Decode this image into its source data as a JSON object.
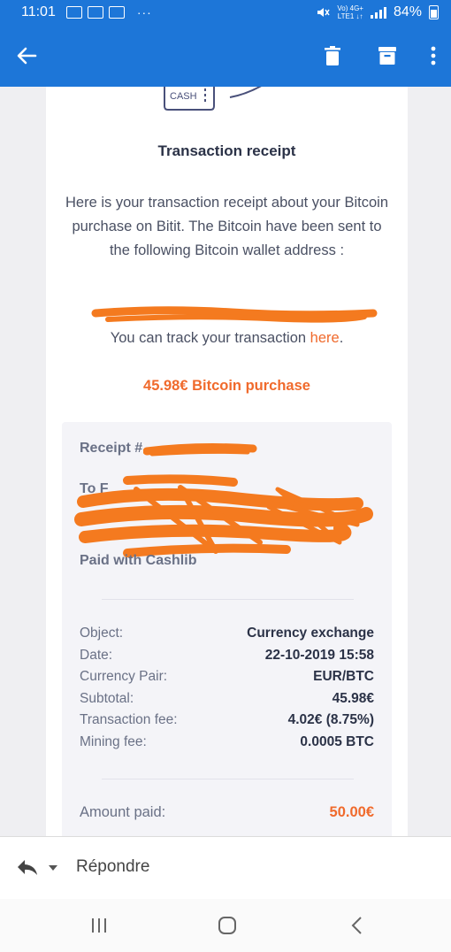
{
  "status": {
    "time": "11:01",
    "battery": "84%",
    "net_top": "Vo) 4G+",
    "net_bottom": "LTE1 ↓↑",
    "dots": "···"
  },
  "header": {
    "back_label": "Back",
    "actions": [
      "delete",
      "archive",
      "more"
    ]
  },
  "email": {
    "title": "Transaction receipt",
    "intro": "Here is your transaction receipt about your Bitcoin purchase on Bitit. The Bitcoin have been sent to the following Bitcoin wallet address :",
    "track_prefix": "You can track your transaction ",
    "track_link": "here",
    "track_suffix": ".",
    "purchase_line": "45.98€ Bitcoin purchase",
    "logo_text": "CASH",
    "receipt": {
      "receipt_label": "Receipt #",
      "to_label": "To F",
      "paid_with": "Paid with Cashlib",
      "rows": [
        {
          "label": "Object:",
          "value": "Currency exchange"
        },
        {
          "label": "Date:",
          "value": "22-10-2019 15:58"
        },
        {
          "label": "Currency Pair:",
          "value": "EUR/BTC"
        },
        {
          "label": "Subtotal:",
          "value": "45.98€"
        },
        {
          "label": "Transaction fee:",
          "value": "4.02€ (8.75%)"
        },
        {
          "label": "Mining fee:",
          "value": "0.0005 BTC"
        }
      ],
      "amount_label": "Amount paid:",
      "amount_value": "50.00€"
    }
  },
  "reply": {
    "label": "Répondre"
  },
  "colors": {
    "header": "#1d76d8",
    "accent": "#f06a2c",
    "redaction": "#f47a1f"
  }
}
